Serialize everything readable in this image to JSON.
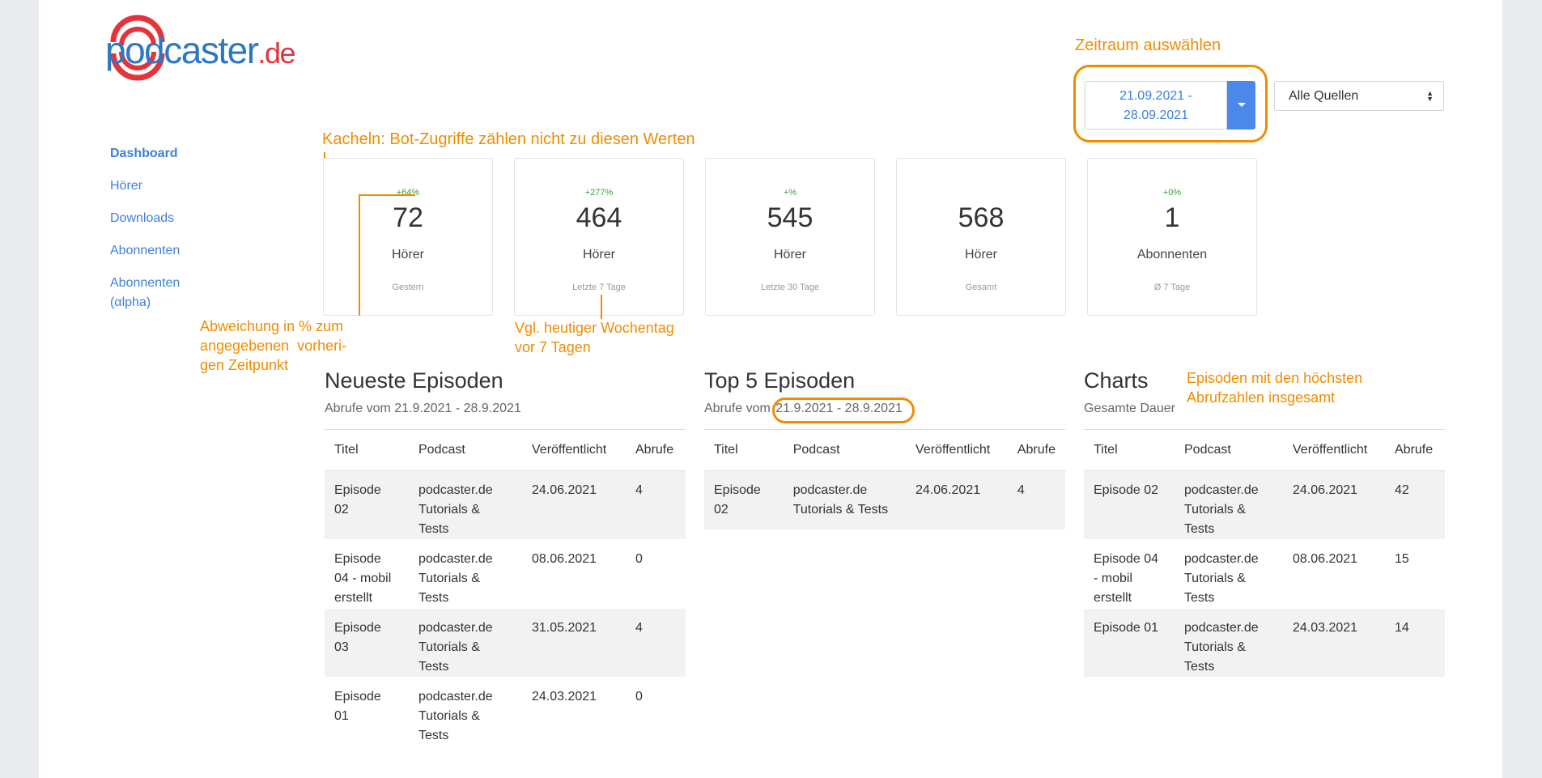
{
  "logo": {
    "pod": "pod",
    "caster": "caster",
    "de": ".de"
  },
  "nav": [
    {
      "label": "Dashboard",
      "active": true
    },
    {
      "label": "Hörer"
    },
    {
      "label": "Downloads"
    },
    {
      "label": "Abonnenten"
    },
    {
      "label": "Abonnenten (αlpha)"
    }
  ],
  "controls": {
    "date_range": "21.09.2021 - 28.09.2021",
    "source_select": "Alle Quellen"
  },
  "tiles": [
    {
      "pct": "+64%",
      "value": "72",
      "label": "Hörer",
      "sub": "Gestern"
    },
    {
      "pct": "+277%",
      "value": "464",
      "label": "Hörer",
      "sub": "Letzte 7 Tage"
    },
    {
      "pct": "+%",
      "value": "545",
      "label": "Hörer",
      "sub": "Letzte 30 Tage"
    },
    {
      "pct": "",
      "value": "568",
      "label": "Hörer",
      "sub": "Gesamt"
    },
    {
      "pct": "+0%",
      "value": "1",
      "label": "Abonnenten",
      "sub": "Ø 7 Tage"
    }
  ],
  "annotations": {
    "zeitraum": "Zeitraum auswählen",
    "kacheln": "Kacheln: Bot-Zugriffe zählen nicht zu diesen Werten",
    "abweichung_1": "Abweichung in % zum",
    "abweichung_2": "angegebenen  vorheri-",
    "abweichung_3": "gen Zeitpunkt",
    "vgl_1": "Vgl. heutiger Wochentag",
    "vgl_2": "vor 7 Tagen",
    "charts_1": "Episoden mit den höchsten",
    "charts_2": "Abrufzahlen insgesamt"
  },
  "sections": {
    "neueste": {
      "title": "Neueste Episoden",
      "sub": "Abrufe vom 21.9.2021 - 28.9.2021"
    },
    "top5": {
      "title": "Top 5 Episoden",
      "sub_prefix": "Abrufe vom",
      "sub_range": "21.9.2021 - 28.9.2021"
    },
    "charts": {
      "title": "Charts",
      "sub": "Gesamte Dauer"
    }
  },
  "table_headers": {
    "titel": "Titel",
    "podcast": "Podcast",
    "veroeffentlicht": "Veröffentlicht",
    "abrufe": "Abrufe"
  },
  "tables": {
    "neueste": [
      {
        "titel": "Episode 02",
        "podcast": "podcaster.de Tutorials & Tests",
        "date": "24.06.2021",
        "abrufe": "4"
      },
      {
        "titel": "Episode 04 - mobil erstellt",
        "podcast": "podcaster.de Tutorials & Tests",
        "date": "08.06.2021",
        "abrufe": "0"
      },
      {
        "titel": "Episode 03",
        "podcast": "podcaster.de Tutorials & Tests",
        "date": "31.05.2021",
        "abrufe": "4"
      },
      {
        "titel": "Episode 01",
        "podcast": "podcaster.de Tutorials & Tests",
        "date": "24.03.2021",
        "abrufe": "0"
      }
    ],
    "top5": [
      {
        "titel": "Episode 02",
        "podcast": "podcaster.de Tutorials & Tests",
        "date": "24.06.2021",
        "abrufe": "4"
      }
    ],
    "charts": [
      {
        "titel": "Episode 02",
        "podcast": "podcaster.de Tutorials & Tests",
        "date": "24.06.2021",
        "abrufe": "42"
      },
      {
        "titel": "Episode 04 - mobil erstellt",
        "podcast": "podcaster.de Tutorials & Tests",
        "date": "08.06.2021",
        "abrufe": "15"
      },
      {
        "titel": "Episode 01",
        "podcast": "podcaster.de Tutorials & Tests",
        "date": "24.03.2021",
        "abrufe": "14"
      }
    ]
  },
  "colors": {
    "accent": "#3d7fe0",
    "annotation": "#f08c00",
    "positive": "#3aa336",
    "logo_red": "#e5333b"
  }
}
